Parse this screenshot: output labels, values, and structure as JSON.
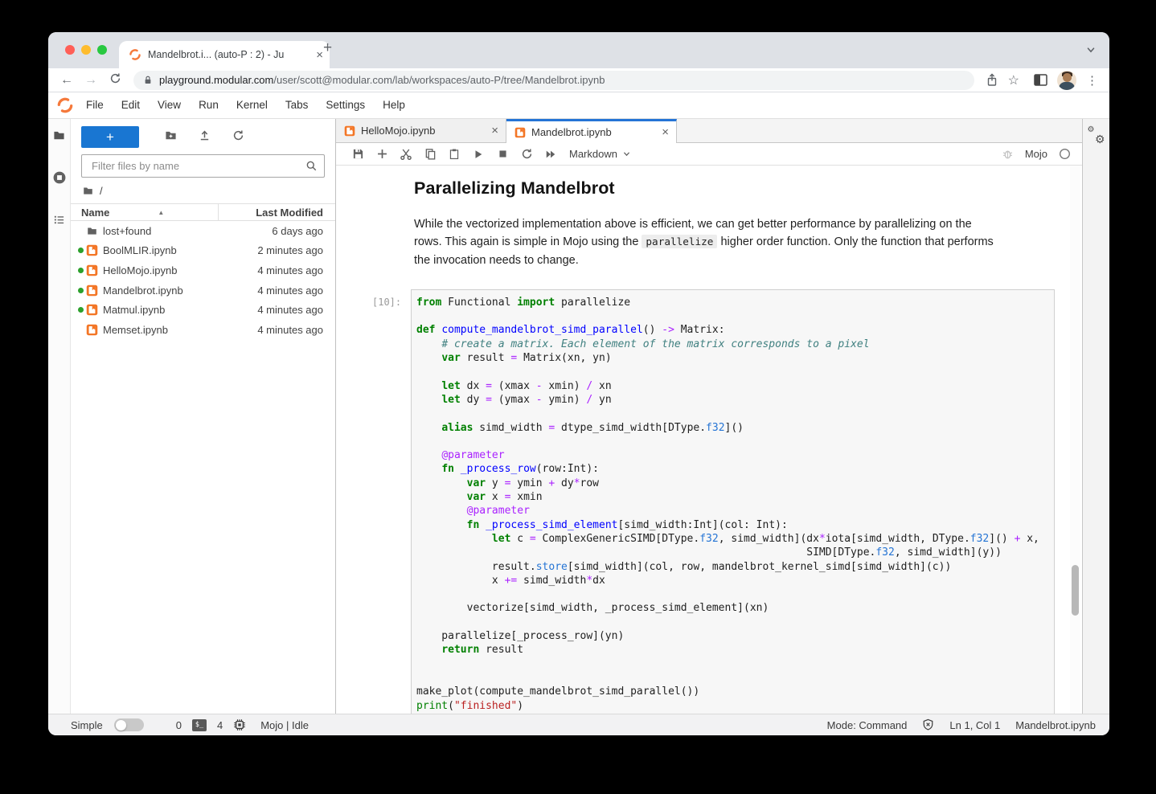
{
  "browser": {
    "tab_title": "Mandelbrot.i... (auto-P : 2) - Ju",
    "url_domain": "playground.modular.com",
    "url_path": "/user/scott@modular.com/lab/workspaces/auto-P/tree/Mandelbrot.ipynb"
  },
  "icons": {
    "star": "☆",
    "dots_menu": "⋮",
    "back_arrow": "←",
    "forward_arrow": "→",
    "sort_asc": "▲",
    "gear": "⚙",
    "terminal_badge": "$_",
    "new_button_plus": "+",
    "close_x": "×"
  },
  "menubar": {
    "items": [
      "File",
      "Edit",
      "View",
      "Run",
      "Kernel",
      "Tabs",
      "Settings",
      "Help"
    ]
  },
  "filebrowser": {
    "filter_placeholder": "Filter files by name",
    "breadcrumb": "/",
    "columns": {
      "name": "Name",
      "modified": "Last Modified"
    },
    "files": [
      {
        "name": "lost+found",
        "modified": "6 days ago",
        "icon": "folder",
        "running": false
      },
      {
        "name": "BoolMLIR.ipynb",
        "modified": "2 minutes ago",
        "icon": "notebook",
        "running": true
      },
      {
        "name": "HelloMojo.ipynb",
        "modified": "4 minutes ago",
        "icon": "notebook",
        "running": true
      },
      {
        "name": "Mandelbrot.ipynb",
        "modified": "4 minutes ago",
        "icon": "notebook",
        "running": true
      },
      {
        "name": "Matmul.ipynb",
        "modified": "4 minutes ago",
        "icon": "notebook",
        "running": true
      },
      {
        "name": "Memset.ipynb",
        "modified": "4 minutes ago",
        "icon": "notebook",
        "running": false
      }
    ]
  },
  "dock": {
    "tabs": [
      {
        "label": "HelloMojo.ipynb",
        "active": false
      },
      {
        "label": "Mandelbrot.ipynb",
        "active": true
      }
    ],
    "toolbar": {
      "cell_type": "Markdown",
      "kernel": "Mojo"
    }
  },
  "notebook": {
    "heading": "Parallelizing Mandelbrot",
    "para_before": "While the vectorized implementation above is efficient, we can get better performance by parallelizing on the rows. This again is simple in Mojo using the ",
    "para_code": "parallelize",
    "para_after": " higher order function. Only the function that performs the invocation needs to change.",
    "cell_prompt": "[10]:",
    "code": {
      "lines": [
        [
          [
            "k",
            "from"
          ],
          [
            "p",
            " Functional "
          ],
          [
            "k",
            "import"
          ],
          [
            "p",
            " parallelize"
          ]
        ],
        [],
        [
          [
            "k",
            "def"
          ],
          [
            "p",
            " "
          ],
          [
            "f",
            "compute_mandelbrot_simd_parallel"
          ],
          [
            "p",
            "() "
          ],
          [
            "o",
            "->"
          ],
          [
            "p",
            " Matrix:"
          ]
        ],
        [
          [
            "p",
            "    "
          ],
          [
            "c",
            "# create a matrix. Each element of the matrix corresponds to a pixel"
          ]
        ],
        [
          [
            "p",
            "    "
          ],
          [
            "k",
            "var"
          ],
          [
            "p",
            " result "
          ],
          [
            "o",
            "="
          ],
          [
            "p",
            " Matrix(xn, yn)"
          ]
        ],
        [],
        [
          [
            "p",
            "    "
          ],
          [
            "k",
            "let"
          ],
          [
            "p",
            " dx "
          ],
          [
            "o",
            "="
          ],
          [
            "p",
            " (xmax "
          ],
          [
            "o",
            "-"
          ],
          [
            "p",
            " xmin) "
          ],
          [
            "o",
            "/"
          ],
          [
            "p",
            " xn"
          ]
        ],
        [
          [
            "p",
            "    "
          ],
          [
            "k",
            "let"
          ],
          [
            "p",
            " dy "
          ],
          [
            "o",
            "="
          ],
          [
            "p",
            " (ymax "
          ],
          [
            "o",
            "-"
          ],
          [
            "p",
            " ymin) "
          ],
          [
            "o",
            "/"
          ],
          [
            "p",
            " yn"
          ]
        ],
        [],
        [
          [
            "p",
            "    "
          ],
          [
            "k",
            "alias"
          ],
          [
            "p",
            " simd_width "
          ],
          [
            "o",
            "="
          ],
          [
            "p",
            " dtype_simd_width[DType."
          ],
          [
            "t",
            "f32"
          ],
          [
            "p",
            "]()"
          ]
        ],
        [],
        [
          [
            "p",
            "    "
          ],
          [
            "o",
            "@parameter"
          ]
        ],
        [
          [
            "p",
            "    "
          ],
          [
            "k",
            "fn"
          ],
          [
            "p",
            " "
          ],
          [
            "f",
            "_process_row"
          ],
          [
            "p",
            "(row:Int):"
          ]
        ],
        [
          [
            "p",
            "        "
          ],
          [
            "k",
            "var"
          ],
          [
            "p",
            " y "
          ],
          [
            "o",
            "="
          ],
          [
            "p",
            " ymin "
          ],
          [
            "o",
            "+"
          ],
          [
            "p",
            " dy"
          ],
          [
            "o",
            "*"
          ],
          [
            "p",
            "row"
          ]
        ],
        [
          [
            "p",
            "        "
          ],
          [
            "k",
            "var"
          ],
          [
            "p",
            " x "
          ],
          [
            "o",
            "="
          ],
          [
            "p",
            " xmin"
          ]
        ],
        [
          [
            "p",
            "        "
          ],
          [
            "o",
            "@parameter"
          ]
        ],
        [
          [
            "p",
            "        "
          ],
          [
            "k",
            "fn"
          ],
          [
            "p",
            " "
          ],
          [
            "f",
            "_process_simd_element"
          ],
          [
            "p",
            "[simd_width:Int](col: Int):"
          ]
        ],
        [
          [
            "p",
            "            "
          ],
          [
            "k",
            "let"
          ],
          [
            "p",
            " c "
          ],
          [
            "o",
            "="
          ],
          [
            "p",
            " ComplexGenericSIMD[DType."
          ],
          [
            "t",
            "f32"
          ],
          [
            "p",
            ", simd_width](dx"
          ],
          [
            "o",
            "*"
          ],
          [
            "p",
            "iota[simd_width, DType."
          ],
          [
            "t",
            "f32"
          ],
          [
            "p",
            "]() "
          ],
          [
            "o",
            "+"
          ],
          [
            "p",
            " x,"
          ]
        ],
        [
          [
            "p",
            "                                                              SIMD[DType."
          ],
          [
            "t",
            "f32"
          ],
          [
            "p",
            ", simd_width](y))"
          ]
        ],
        [
          [
            "p",
            "            result."
          ],
          [
            "t",
            "store"
          ],
          [
            "p",
            "[simd_width](col, row, mandelbrot_kernel_simd[simd_width](c))"
          ]
        ],
        [
          [
            "p",
            "            x "
          ],
          [
            "o",
            "+="
          ],
          [
            "p",
            " simd_width"
          ],
          [
            "o",
            "*"
          ],
          [
            "p",
            "dx"
          ]
        ],
        [],
        [
          [
            "p",
            "        vectorize[simd_width, _process_simd_element](xn)"
          ]
        ],
        [],
        [
          [
            "p",
            "    parallelize[_process_row](yn)"
          ]
        ],
        [
          [
            "p",
            "    "
          ],
          [
            "k",
            "return"
          ],
          [
            "p",
            " result"
          ]
        ],
        [],
        [],
        [
          [
            "p",
            "make_plot(compute_mandelbrot_simd_parallel())"
          ]
        ],
        [
          [
            "b",
            "print"
          ],
          [
            "p",
            "("
          ],
          [
            "s",
            "\"finished\""
          ],
          [
            "p",
            ")"
          ]
        ]
      ]
    }
  },
  "statusbar": {
    "simple_label": "Simple",
    "terminals_count": "0",
    "kernels_count": "4",
    "kernel_status": "Mojo | Idle",
    "mode": "Mode: Command",
    "cursor_position": "Ln 1, Col 1",
    "filename": "Mandelbrot.ipynb"
  },
  "colors": {
    "accent_blue": "#1976d2",
    "active_tab_border": "#2474d6",
    "notebook_icon_orange": "#f37626",
    "running_dot_green": "#2ca02c"
  }
}
